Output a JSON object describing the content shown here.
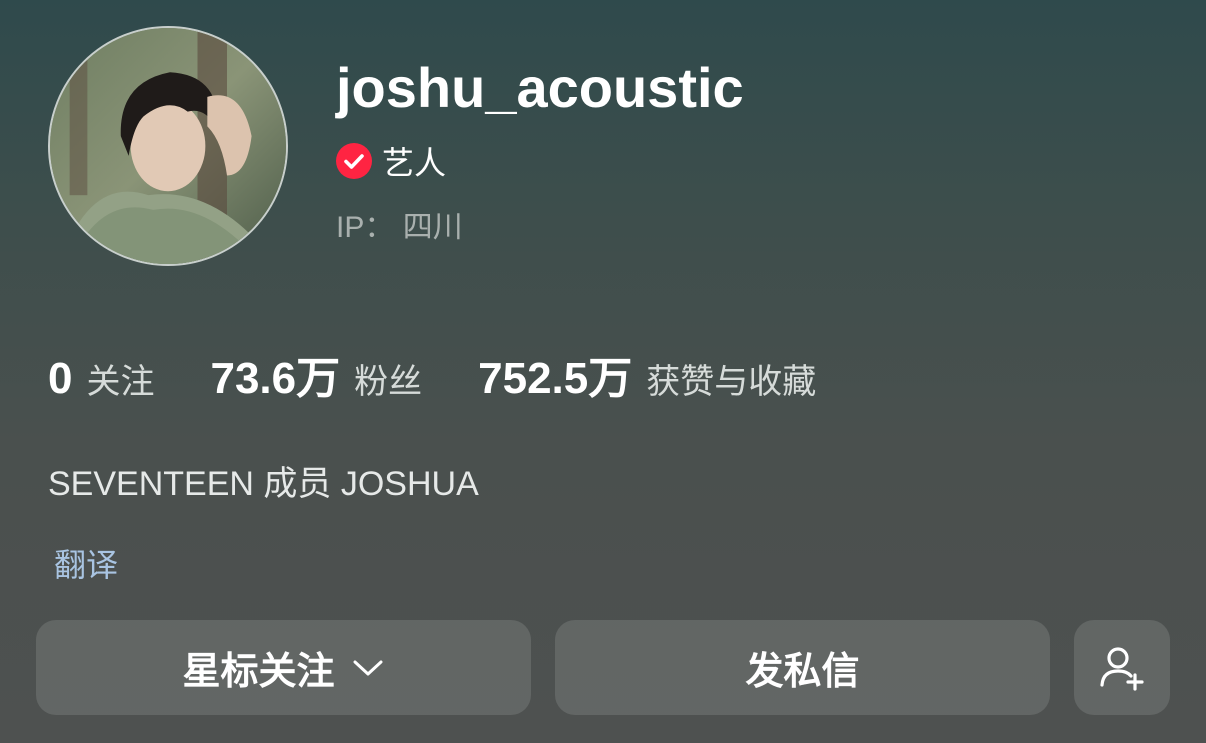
{
  "profile": {
    "username": "joshu_acoustic",
    "verified_label": "艺人",
    "ip_label": "IP：",
    "ip_location": "四川",
    "avatar_icon": "avatar-photo"
  },
  "stats": [
    {
      "value": "0",
      "label": "关注"
    },
    {
      "value": "73.6万",
      "label": "粉丝"
    },
    {
      "value": "752.5万",
      "label": "获赞与收藏"
    }
  ],
  "bio": "SEVENTEEN 成员 JOSHUA",
  "translate_link": "翻译",
  "actions": {
    "star_follow_label": "星标关注",
    "message_label": "发私信",
    "add_friend_icon": "add-user-icon",
    "dropdown_icon": "chevron-down-icon"
  },
  "colors": {
    "verified_badge": "#ff2442",
    "translate_link": "#a9c4e2",
    "secondary_text": "#a9b0ae",
    "button_bg": "rgba(255,255,255,0.12)"
  }
}
